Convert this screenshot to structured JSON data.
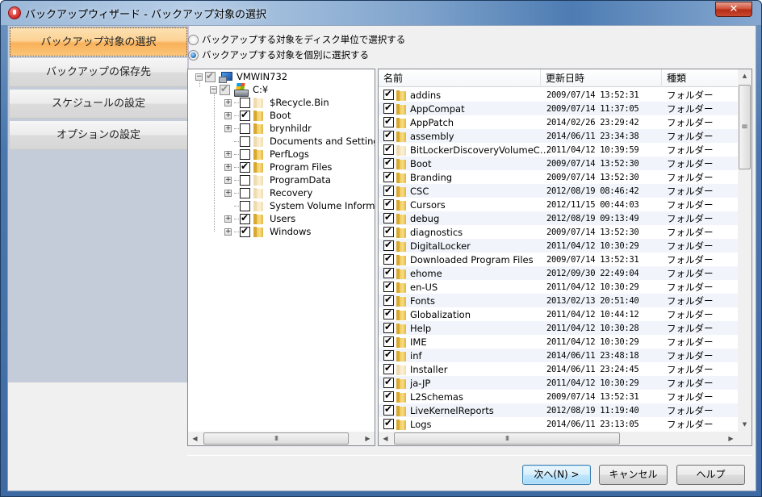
{
  "window": {
    "title": "バックアップウィザード - バックアップ対象の選択",
    "close_glyph": "✕"
  },
  "sidebar": {
    "items": [
      {
        "label": "バックアップ対象の選択",
        "active": true
      },
      {
        "label": "バックアップの保存先",
        "active": false
      },
      {
        "label": "スケジュールの設定",
        "active": false
      },
      {
        "label": "オプションの設定",
        "active": false
      }
    ]
  },
  "selection_mode": {
    "options": [
      {
        "label": "バックアップする対象をディスク単位で選択する",
        "selected": false
      },
      {
        "label": "バックアップする対象を個別に選択する",
        "selected": true
      }
    ]
  },
  "tree": {
    "root": {
      "label": "VMWIN732",
      "icon": "computer-icon",
      "state": "partial",
      "expanded": true
    },
    "drive": {
      "label": "C:¥",
      "icon": "drive-icon",
      "state": "partial",
      "expanded": true
    },
    "folders": [
      {
        "label": "$Recycle.Bin",
        "checked": false,
        "expandable": true,
        "hidden": true
      },
      {
        "label": "Boot",
        "checked": true,
        "expandable": true,
        "hidden": false
      },
      {
        "label": "brynhildr",
        "checked": false,
        "expandable": true,
        "hidden": false
      },
      {
        "label": "Documents and Settings",
        "checked": false,
        "expandable": false,
        "hidden": true
      },
      {
        "label": "PerfLogs",
        "checked": false,
        "expandable": true,
        "hidden": false
      },
      {
        "label": "Program Files",
        "checked": true,
        "expandable": true,
        "hidden": false
      },
      {
        "label": "ProgramData",
        "checked": false,
        "expandable": true,
        "hidden": true
      },
      {
        "label": "Recovery",
        "checked": false,
        "expandable": true,
        "hidden": true
      },
      {
        "label": "System Volume Informatio",
        "checked": false,
        "expandable": false,
        "hidden": true
      },
      {
        "label": "Users",
        "checked": true,
        "expandable": true,
        "hidden": false
      },
      {
        "label": "Windows",
        "checked": true,
        "expandable": true,
        "hidden": false
      }
    ]
  },
  "file_list": {
    "columns": [
      "名前",
      "更新日時",
      "種類"
    ],
    "rows": [
      {
        "name": "addins",
        "date": "2009/07/14 13:52:31",
        "type": "フォルダー",
        "checked": true,
        "hidden": false
      },
      {
        "name": "AppCompat",
        "date": "2009/07/14 11:37:05",
        "type": "フォルダー",
        "checked": true,
        "hidden": false
      },
      {
        "name": "AppPatch",
        "date": "2014/02/26 23:29:42",
        "type": "フォルダー",
        "checked": true,
        "hidden": false
      },
      {
        "name": "assembly",
        "date": "2014/06/11 23:34:38",
        "type": "フォルダー",
        "checked": true,
        "hidden": false
      },
      {
        "name": "BitLockerDiscoveryVolumeCo...",
        "date": "2011/04/12 10:39:59",
        "type": "フォルダー",
        "checked": true,
        "hidden": true
      },
      {
        "name": "Boot",
        "date": "2009/07/14 13:52:30",
        "type": "フォルダー",
        "checked": true,
        "hidden": false
      },
      {
        "name": "Branding",
        "date": "2009/07/14 13:52:30",
        "type": "フォルダー",
        "checked": true,
        "hidden": false
      },
      {
        "name": "CSC",
        "date": "2012/08/19 08:46:42",
        "type": "フォルダー",
        "checked": true,
        "hidden": false
      },
      {
        "name": "Cursors",
        "date": "2012/11/15 00:44:03",
        "type": "フォルダー",
        "checked": true,
        "hidden": false
      },
      {
        "name": "debug",
        "date": "2012/08/19 09:13:49",
        "type": "フォルダー",
        "checked": true,
        "hidden": false
      },
      {
        "name": "diagnostics",
        "date": "2009/07/14 13:52:30",
        "type": "フォルダー",
        "checked": true,
        "hidden": false
      },
      {
        "name": "DigitalLocker",
        "date": "2011/04/12 10:30:29",
        "type": "フォルダー",
        "checked": true,
        "hidden": false
      },
      {
        "name": "Downloaded Program Files",
        "date": "2009/07/14 13:52:31",
        "type": "フォルダー",
        "checked": true,
        "hidden": false
      },
      {
        "name": "ehome",
        "date": "2012/09/30 22:49:04",
        "type": "フォルダー",
        "checked": true,
        "hidden": false
      },
      {
        "name": "en-US",
        "date": "2011/04/12 10:30:29",
        "type": "フォルダー",
        "checked": true,
        "hidden": false
      },
      {
        "name": "Fonts",
        "date": "2013/02/13 20:51:40",
        "type": "フォルダー",
        "checked": true,
        "hidden": false
      },
      {
        "name": "Globalization",
        "date": "2011/04/12 10:44:12",
        "type": "フォルダー",
        "checked": true,
        "hidden": false
      },
      {
        "name": "Help",
        "date": "2011/04/12 10:30:28",
        "type": "フォルダー",
        "checked": true,
        "hidden": false
      },
      {
        "name": "IME",
        "date": "2011/04/12 10:30:29",
        "type": "フォルダー",
        "checked": true,
        "hidden": false
      },
      {
        "name": "inf",
        "date": "2014/06/11 23:48:18",
        "type": "フォルダー",
        "checked": true,
        "hidden": false
      },
      {
        "name": "Installer",
        "date": "2014/06/11 23:24:45",
        "type": "フォルダー",
        "checked": true,
        "hidden": true
      },
      {
        "name": "ja-JP",
        "date": "2011/04/12 10:30:29",
        "type": "フォルダー",
        "checked": true,
        "hidden": false
      },
      {
        "name": "L2Schemas",
        "date": "2009/07/14 13:52:31",
        "type": "フォルダー",
        "checked": true,
        "hidden": false
      },
      {
        "name": "LiveKernelReports",
        "date": "2012/08/19 11:19:40",
        "type": "フォルダー",
        "checked": true,
        "hidden": false
      },
      {
        "name": "Logs",
        "date": "2014/06/11 23:13:05",
        "type": "フォルダー",
        "checked": true,
        "hidden": false
      }
    ]
  },
  "scrollbars": {
    "grip_glyph": "III",
    "vgrip_glyph": "≡",
    "up": "▲",
    "down": "▼",
    "left": "◀",
    "right": "▶"
  },
  "footer": {
    "next_label": "次へ(N) >",
    "cancel_label": "キャンセル",
    "help_label": "ヘルプ"
  }
}
